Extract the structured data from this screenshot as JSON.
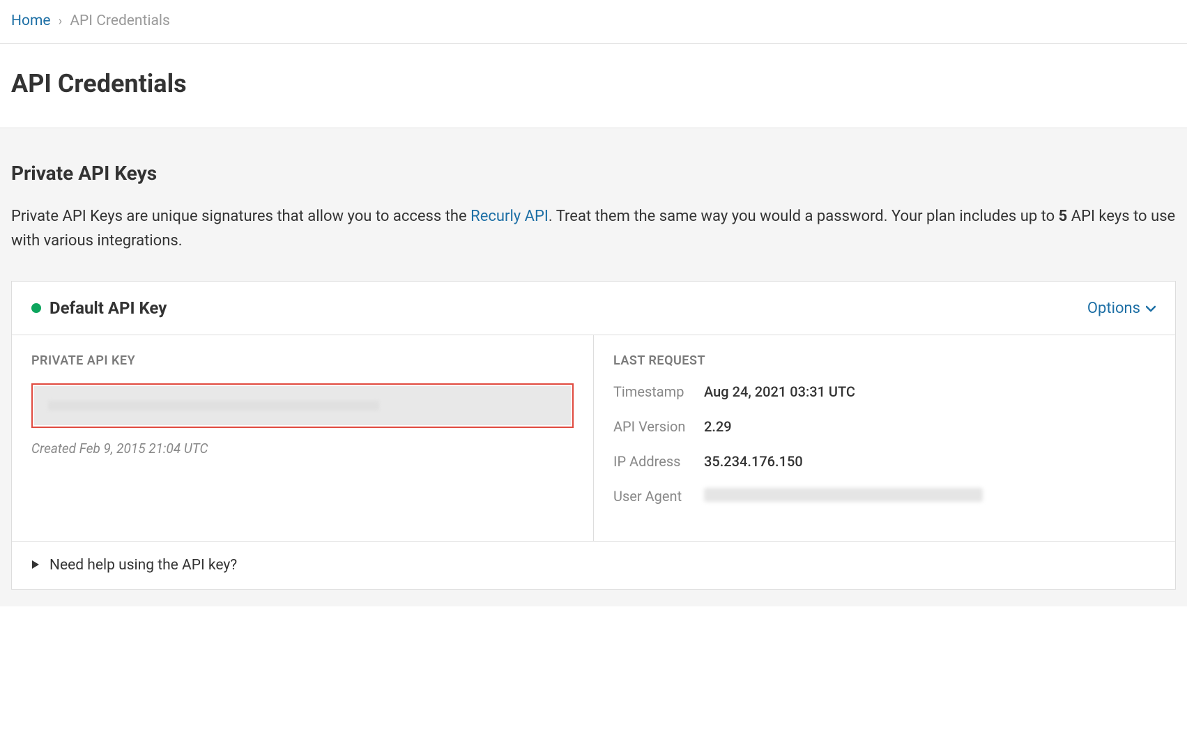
{
  "breadcrumb": {
    "home": "Home",
    "current": "API Credentials"
  },
  "page": {
    "title": "API Credentials"
  },
  "section": {
    "heading": "Private API Keys",
    "desc_part1": "Private API Keys are unique signatures that allow you to access the ",
    "desc_link": "Recurly API",
    "desc_part2": ". Treat them the same way you would a password. Your plan includes up to ",
    "desc_bold": "5",
    "desc_part3": " API keys to use with various integrations."
  },
  "card": {
    "title": "Default API Key",
    "options_label": "Options",
    "private_key_label": "PRIVATE API KEY",
    "created_text": "Created Feb 9, 2015 21:04 UTC",
    "last_request_label": "LAST REQUEST",
    "details": {
      "timestamp_label": "Timestamp",
      "timestamp_value": "Aug 24, 2021 03:31 UTC",
      "api_version_label": "API Version",
      "api_version_value": "2.29",
      "ip_label": "IP Address",
      "ip_value": "35.234.176.150",
      "user_agent_label": "User Agent"
    },
    "help_text": "Need help using the API key?"
  }
}
